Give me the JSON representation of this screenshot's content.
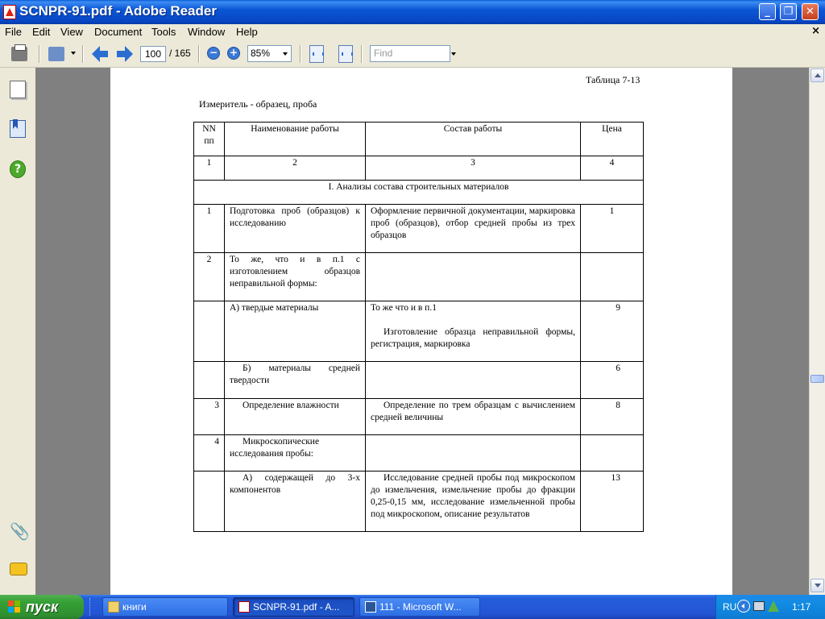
{
  "window": {
    "title": "SCNPR-91.pdf - Adobe Reader",
    "min_glyph": "_",
    "max_glyph": "❐",
    "close_glyph": "✕"
  },
  "menu": {
    "items": [
      "File",
      "Edit",
      "View",
      "Document",
      "Tools",
      "Window",
      "Help"
    ],
    "doc_close": "×"
  },
  "toolbar": {
    "page_current": "100",
    "page_total": "/ 165",
    "zoom_out": "−",
    "zoom_in": "+",
    "zoom": "85%",
    "find_placeholder": "Find"
  },
  "nav_pane": {
    "help_glyph": "?",
    "attachments_glyph": "📎"
  },
  "document": {
    "table_number": "Таблица 7-13",
    "measurer": "Измеритель - образец, проба",
    "header": {
      "nn": "NN пп",
      "name": "Наименование работы",
      "composition": "Состав работы",
      "price": "Цена"
    },
    "col_numbers": [
      "1",
      "2",
      "3",
      "4"
    ],
    "section": "I. Анализы состава строительных материалов",
    "rows": [
      {
        "nn": "1",
        "name": "Подготовка проб (образцов) к исследованию",
        "composition": "Оформление первичной документации, маркировка проб (образцов), отбор средней пробы из трех образцов",
        "price": "1"
      },
      {
        "nn": "2",
        "name": "То же, что и в п.1 с изготовлением образцов неправильной формы:",
        "composition": "",
        "price": ""
      },
      {
        "nn": "",
        "name": "А) твердые материалы",
        "composition_line1": "То же что и в п.1",
        "composition": "Изготовление образца неправильной формы, регистрация, маркировка",
        "price": "9"
      },
      {
        "nn": "",
        "name": "Б) материалы средней твердости",
        "composition": "",
        "price": "6"
      },
      {
        "nn": "3",
        "name": "Определение влажности",
        "composition": "Определение по трем образцам с вычислением средней величины",
        "price": "8"
      },
      {
        "nn": "4",
        "name": "Микроскопические исследования пробы:",
        "composition": "",
        "price": ""
      },
      {
        "nn": "",
        "name": "А) содержащей до 3-х компонентов",
        "composition": "Исследование средней пробы под микроскопом до измельчения, измельчение пробы до фракции 0,25-0,15 мм, исследование измельченной пробы под микроскопом, описание результатов",
        "price": "13"
      }
    ]
  },
  "taskbar": {
    "start": "пуск",
    "tasks": [
      "книги",
      "SCNPR-91.pdf - A...",
      "111 - Microsoft W..."
    ],
    "lang": "RU",
    "clock": "1:17"
  }
}
